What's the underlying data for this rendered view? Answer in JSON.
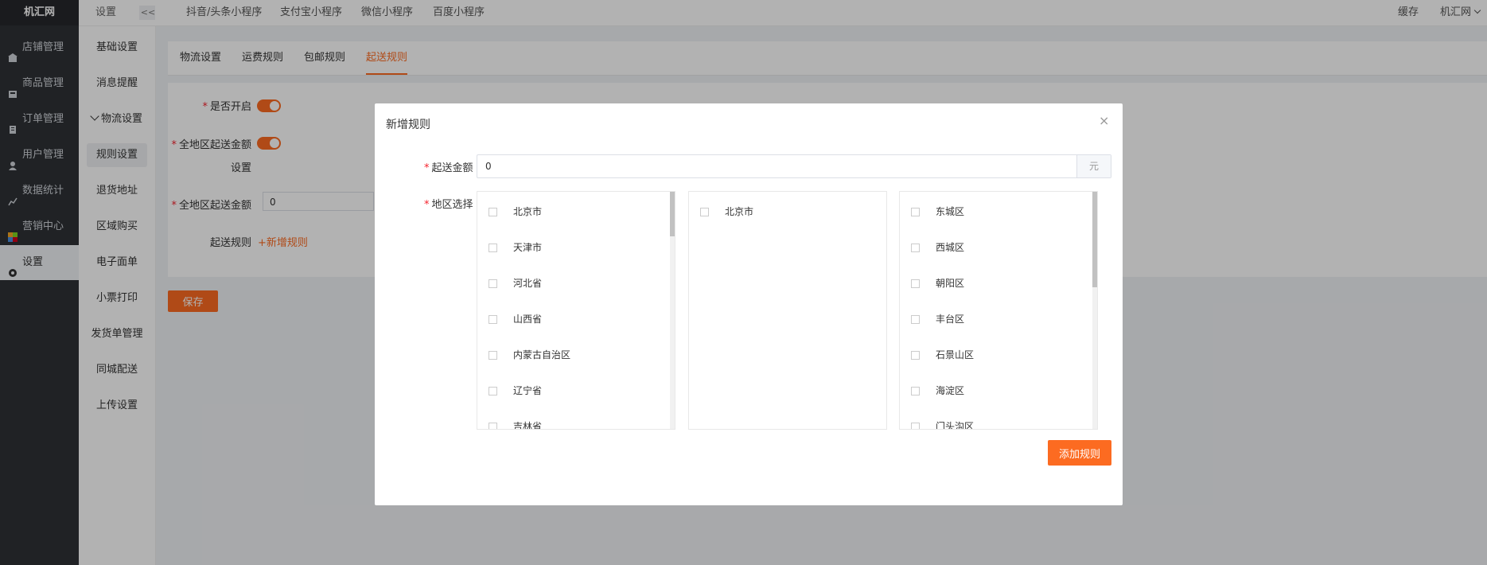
{
  "app": {
    "logo": "机汇网"
  },
  "sidebar": {
    "items": [
      {
        "label": "店铺管理",
        "icon": "store-icon"
      },
      {
        "label": "商品管理",
        "icon": "goods-icon"
      },
      {
        "label": "订单管理",
        "icon": "order-icon"
      },
      {
        "label": "用户管理",
        "icon": "user-icon"
      },
      {
        "label": "数据统计",
        "icon": "chart-icon"
      },
      {
        "label": "营销中心",
        "icon": "marketing-icon"
      },
      {
        "label": "设置",
        "icon": "gear-icon"
      }
    ]
  },
  "subbar": {
    "header": "设置",
    "collapse": "<<",
    "items": [
      "基础设置",
      "消息提醒",
      "物流设置",
      "规则设置",
      "退货地址",
      "区域购买",
      "电子面单",
      "小票打印",
      "发货单管理",
      "同城配送",
      "上传设置"
    ]
  },
  "topbar": {
    "links": [
      "抖音/头条小程序",
      "支付宝小程序",
      "微信小程序",
      "百度小程序"
    ],
    "cache": "缓存",
    "user": "机汇网"
  },
  "tabs": [
    "物流设置",
    "运费规则",
    "包邮规则",
    "起送规则"
  ],
  "form": {
    "enable_label": "是否开启",
    "all_region_label_a": "全地区起送金额",
    "all_region_label_b": "设置",
    "all_region_amount_label": "全地区起送金额",
    "all_region_amount_value": "0",
    "rule_label": "起送规则",
    "add_rule_link": "+新增规则"
  },
  "save_button": "保存",
  "modal": {
    "title": "新增规则",
    "close": "×",
    "amount_label": "起送金额",
    "amount_value": "0",
    "amount_suffix": "元",
    "region_label": "地区选择",
    "provinces": [
      "北京市",
      "天津市",
      "河北省",
      "山西省",
      "内蒙古自治区",
      "辽宁省",
      "吉林省"
    ],
    "cities": [
      "北京市"
    ],
    "districts": [
      "东城区",
      "西城区",
      "朝阳区",
      "丰台区",
      "石景山区",
      "海淀区",
      "门头沟区"
    ],
    "add_button": "添加规则"
  },
  "colors": {
    "accent": "#fc6b21",
    "sidebar": "#2e3136"
  }
}
